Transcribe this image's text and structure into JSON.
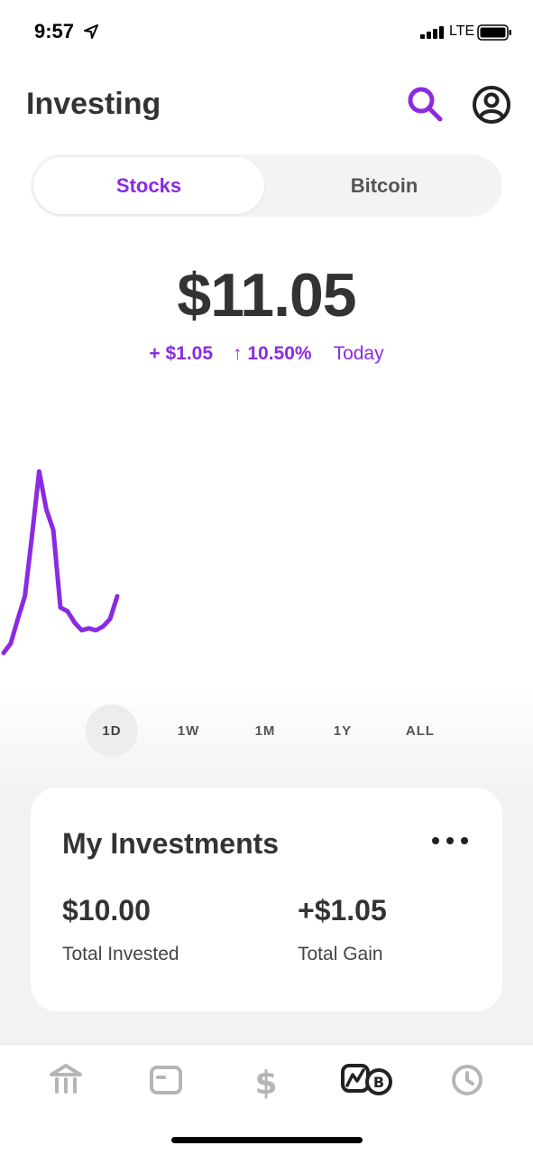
{
  "status_bar": {
    "time": "9:57",
    "network": "LTE"
  },
  "header": {
    "title": "Investing"
  },
  "tabs": [
    {
      "label": "Stocks",
      "active": true
    },
    {
      "label": "Bitcoin",
      "active": false
    }
  ],
  "portfolio": {
    "balance": "$11.05",
    "change_amount": "+ $1.05",
    "change_percent": "↑ 10.50%",
    "period": "Today"
  },
  "chart_data": {
    "type": "line",
    "series_color": "#8a2be2",
    "values": [
      0.0,
      0.5,
      1.8,
      3.0,
      6.2,
      9.6,
      7.6,
      6.5,
      2.4,
      2.2,
      1.6,
      1.2,
      1.3,
      1.2,
      1.4,
      1.8,
      3.0
    ]
  },
  "ranges": [
    "1D",
    "1W",
    "1M",
    "1Y",
    "ALL"
  ],
  "active_range": "1D",
  "investments": {
    "title": "My Investments",
    "total_invested_value": "$10.00",
    "total_invested_label": "Total Invested",
    "total_gain_value": "+$1.05",
    "total_gain_label": "Total Gain"
  },
  "colors": {
    "accent": "#8a2be2",
    "text": "#333333",
    "muted": "#b5b5b5"
  },
  "nav_icons": [
    "bank-icon",
    "card-icon",
    "dollar-icon",
    "investing-icon",
    "activity-clock-icon"
  ]
}
